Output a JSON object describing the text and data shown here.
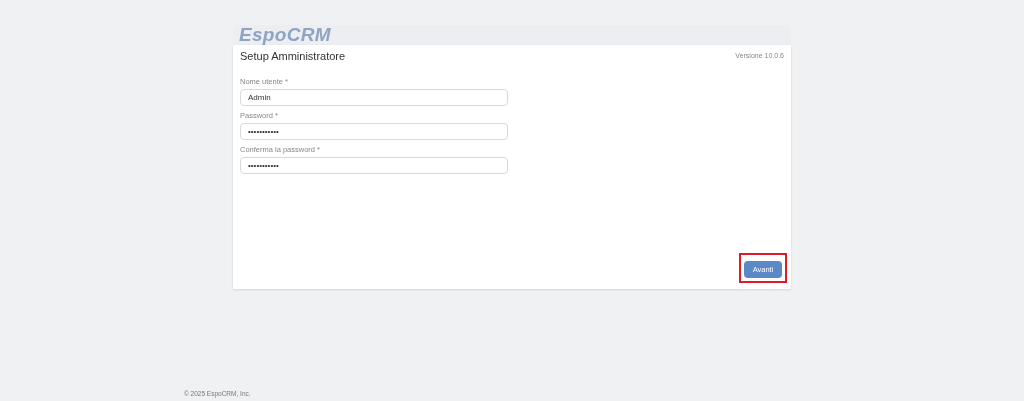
{
  "logo": "EspoCRM",
  "panel": {
    "title": "Setup Amministratore",
    "version": "Versione 10.0.6"
  },
  "fields": [
    {
      "label": "Nome utente *",
      "value": "Admin"
    },
    {
      "label": "Password *",
      "value": "•••••••••••"
    },
    {
      "label": "Conferma la password *",
      "value": "•••••••••••"
    }
  ],
  "button": {
    "label": "Avanti",
    "highlighted": true
  },
  "footer": "© 2025 EspoCRM, Inc."
}
